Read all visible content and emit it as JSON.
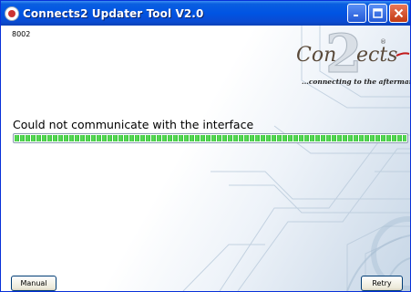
{
  "window": {
    "title": "Connects2 Updater Tool V2.0",
    "icon": "app-icon",
    "controls": [
      "minimize-icon",
      "maximize-icon",
      "close-icon"
    ]
  },
  "main": {
    "code": "8002",
    "status_message": "Could not communicate with the interface",
    "progress_value": 1.0,
    "progress_color": "#38c43a"
  },
  "logo": {
    "digit": "2",
    "tagline": "...connecting to the aftermarket"
  },
  "buttons": {
    "manual_label": "Manual",
    "retry_label": "Retry"
  }
}
